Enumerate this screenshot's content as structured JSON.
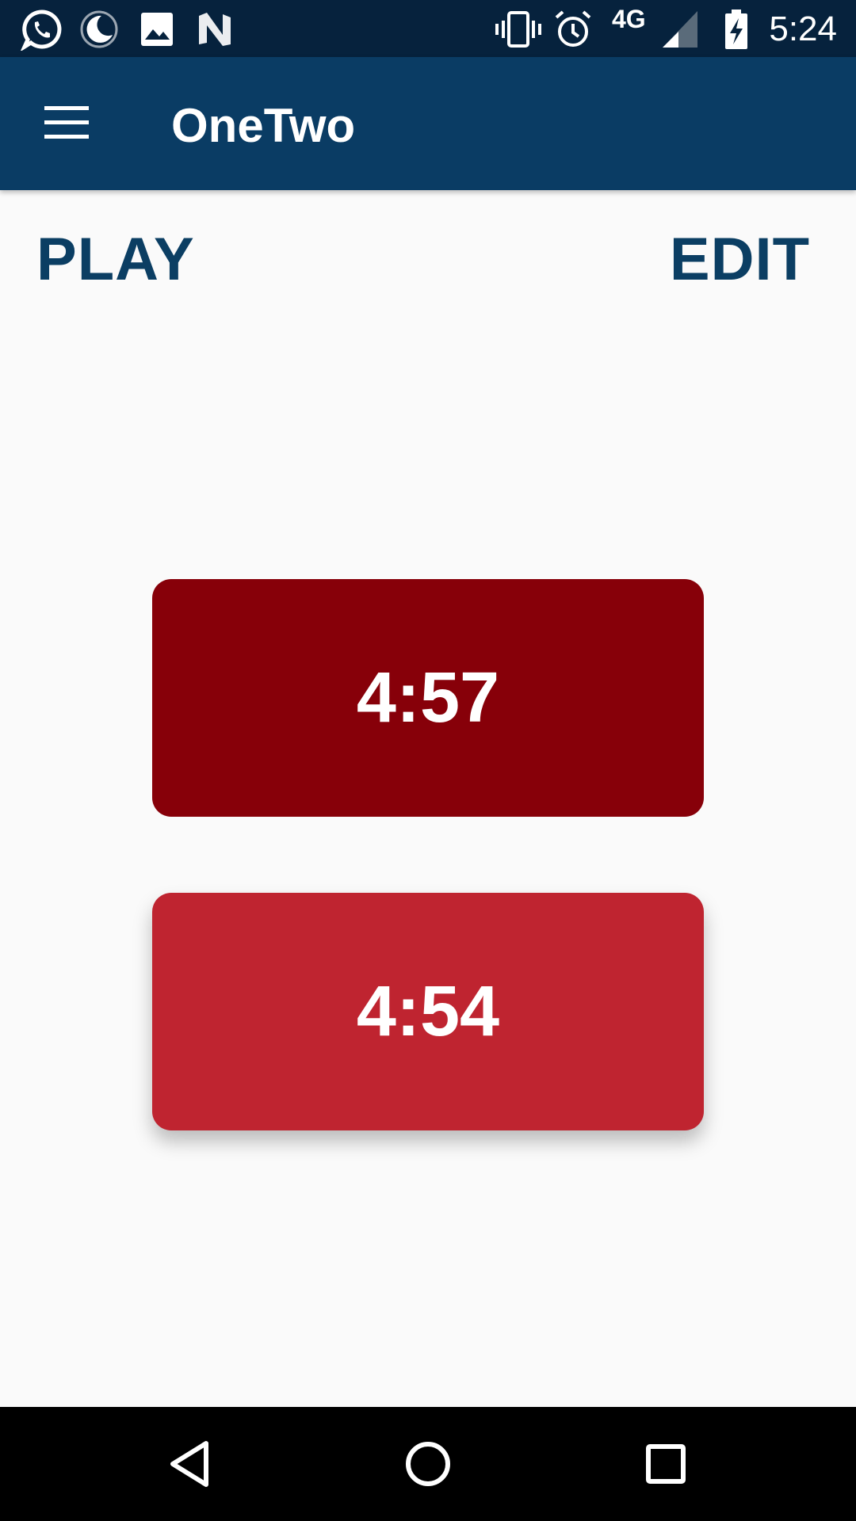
{
  "status_bar": {
    "icons": [
      "whatsapp-icon",
      "night-mode-icon",
      "image-icon",
      "n-logo-icon",
      "vibrate-icon",
      "alarm-icon",
      "signal-icon",
      "battery-charging-icon"
    ],
    "network": "4G",
    "time": "5:24"
  },
  "app_bar": {
    "title": "OneTwo",
    "menu_icon": "hamburger-menu-icon",
    "background": "#0a3c64"
  },
  "mode_tabs": {
    "play_label": "PLAY",
    "edit_label": "EDIT",
    "color": "#0b3e63"
  },
  "timers": [
    {
      "time": "4:57",
      "color": "#870009"
    },
    {
      "time": "4:54",
      "color": "#bf2430"
    }
  ],
  "nav_bar": {
    "icons": [
      "back-icon",
      "home-icon",
      "recents-icon"
    ]
  }
}
